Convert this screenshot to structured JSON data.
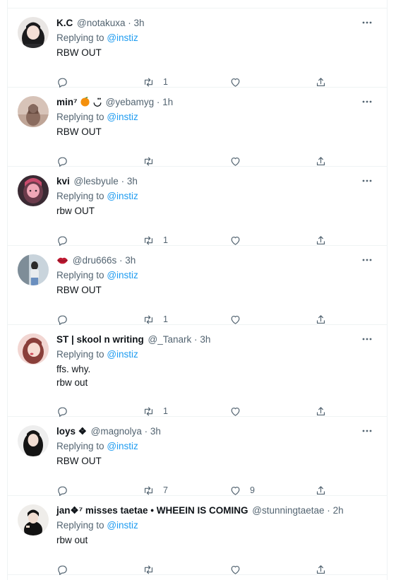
{
  "replying_label": "Replying to",
  "tweets": [
    {
      "name": "K.C",
      "handle": "@notakuxa",
      "dot": "·",
      "time": "3h",
      "reply_to": "@instiz",
      "text": "RBW OUT",
      "replies": "",
      "retweets": "1",
      "likes": ""
    },
    {
      "name": "min⁷",
      "name_suffix": "◡̈",
      "handle": "@yebamyg",
      "dot": "·",
      "time": "1h",
      "reply_to": "@instiz",
      "text": "RBW OUT",
      "replies": "",
      "retweets": "",
      "likes": ""
    },
    {
      "name": "kvi",
      "handle": "@lesbyule",
      "dot": "·",
      "time": "3h",
      "reply_to": "@instiz",
      "text": "rbw OUT",
      "replies": "",
      "retweets": "1",
      "likes": ""
    },
    {
      "name": "",
      "handle": "@dru666s",
      "dot": "·",
      "time": "3h",
      "reply_to": "@instiz",
      "text": "RBW OUT",
      "replies": "",
      "retweets": "1",
      "likes": ""
    },
    {
      "name": "ST | skool n writing",
      "handle": "@_Tanark",
      "dot": "·",
      "time": "3h",
      "reply_to": "@instiz",
      "text": "ffs. why.\nrbw out",
      "replies": "",
      "retweets": "1",
      "likes": ""
    },
    {
      "name": "loys ❖",
      "handle": "@magnolya",
      "dot": "·",
      "time": "3h",
      "reply_to": "@instiz",
      "text": "RBW OUT",
      "replies": "",
      "retweets": "7",
      "likes": "9"
    },
    {
      "name": "jan❖⁷ misses taetae • WHEEIN IS COMING",
      "handle": "@stunningtaetae",
      "dot": "·",
      "time": "2h",
      "reply_to": "@instiz",
      "text": "rbw out",
      "replies": "",
      "retweets": "",
      "likes": ""
    }
  ],
  "icons": {
    "more": "more-horizontal-icon",
    "reply": "reply-icon",
    "retweet": "retweet-icon",
    "like": "heart-icon",
    "share": "share-icon",
    "emoji_orange": "orange-emoji",
    "emoji_lips": "lips-emoji"
  },
  "colors": {
    "link": "#1d9bf0",
    "secondary": "#536471",
    "primary": "#0f1419",
    "border": "#eff3f4"
  }
}
